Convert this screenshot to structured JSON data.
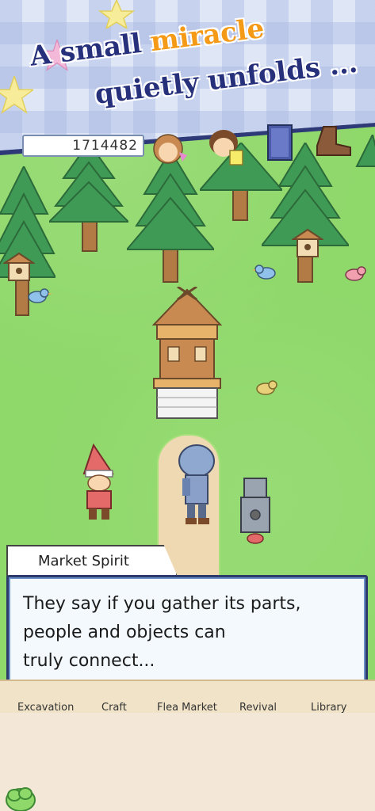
{
  "banner": {
    "line1_a": "A small",
    "line1_b": "miracle",
    "line2": "quietly unfolds ..."
  },
  "hud": {
    "counter": "1714482"
  },
  "dialogue": {
    "speaker": "Market Spirit",
    "line1": "They say if you gather its parts,",
    "line2": "people and objects can",
    "line3": "truly connect..."
  },
  "nav": {
    "items": [
      "Excavation",
      "Craft",
      "Flea Market",
      "Revival",
      "Library"
    ]
  },
  "colors": {
    "headline": "#27307a",
    "highlight": "#f59a16",
    "grass": "#8fd86a",
    "dialog_border": "#2b3a6b"
  }
}
